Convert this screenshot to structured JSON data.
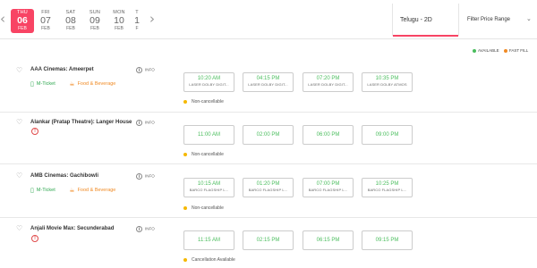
{
  "dates": [
    {
      "dow": "THU",
      "num": "06",
      "mon": "FEB",
      "active": true
    },
    {
      "dow": "FRI",
      "num": "07",
      "mon": "FEB",
      "active": false
    },
    {
      "dow": "SAT",
      "num": "08",
      "mon": "FEB",
      "active": false
    },
    {
      "dow": "SUN",
      "num": "09",
      "mon": "FEB",
      "active": false
    },
    {
      "dow": "MON",
      "num": "10",
      "mon": "FEB",
      "active": false
    },
    {
      "dow": "T",
      "num": "1",
      "mon": "F",
      "active": false
    }
  ],
  "nav": {
    "prev_icon": "‹",
    "next_icon": "›"
  },
  "language": "Telugu - 2D",
  "filter": {
    "label": "Filter Price Range",
    "chevron": "⌄"
  },
  "legend": [
    {
      "label": "AVAILABLE",
      "color": "#4abd5d"
    },
    {
      "label": "FAST FILL",
      "color": "#f08a24"
    }
  ],
  "info_label": "INFO",
  "colors": {
    "accent": "#f84464",
    "available": "#4abd5d",
    "food": "#f08a24",
    "warn": "#e04a4a",
    "note_dot": "#f5b800"
  },
  "cinemas": [
    {
      "name": "AAA Cinemas: Ameerpet",
      "amenities": {
        "mticket": "M-Ticket",
        "food": "Food & Beverage"
      },
      "shows": [
        {
          "time": "10:20 AM",
          "format": "LASER DOLBY DIGIT..."
        },
        {
          "time": "04:15 PM",
          "format": "LASER DOLBY DIGIT..."
        },
        {
          "time": "07:20 PM",
          "format": "LASER DOLBY DIGIT..."
        },
        {
          "time": "10:35 PM",
          "format": "LASER DOLBY ATMOS"
        }
      ],
      "note": "Non-cancellable"
    },
    {
      "name": "Alankar (Pratap Theatre): Langer House",
      "warning": "!",
      "shows": [
        {
          "time": "11:00 AM"
        },
        {
          "time": "02:00 PM"
        },
        {
          "time": "06:00 PM"
        },
        {
          "time": "09:00 PM"
        }
      ],
      "note": "Non-cancellable"
    },
    {
      "name": "AMB Cinemas: Gachibowli",
      "amenities": {
        "mticket": "M-Ticket",
        "food": "Food & Beverage"
      },
      "shows": [
        {
          "time": "10:15 AM",
          "format": "BARCO FLAGSHIP L..."
        },
        {
          "time": "01:20 PM",
          "format": "BARCO FLAGSHIP L..."
        },
        {
          "time": "07:00 PM",
          "format": "BARCO FLAGSHIP L..."
        },
        {
          "time": "10:25 PM",
          "format": "BARCO FLAGSHIP L..."
        }
      ],
      "note": "Non-cancellable"
    },
    {
      "name": "Anjali Movie Max: Secunderabad",
      "warning": "!",
      "shows": [
        {
          "time": "11:15 AM"
        },
        {
          "time": "02:15 PM"
        },
        {
          "time": "06:15 PM"
        },
        {
          "time": "09:15 PM"
        }
      ],
      "note": "Cancellation Available"
    }
  ]
}
